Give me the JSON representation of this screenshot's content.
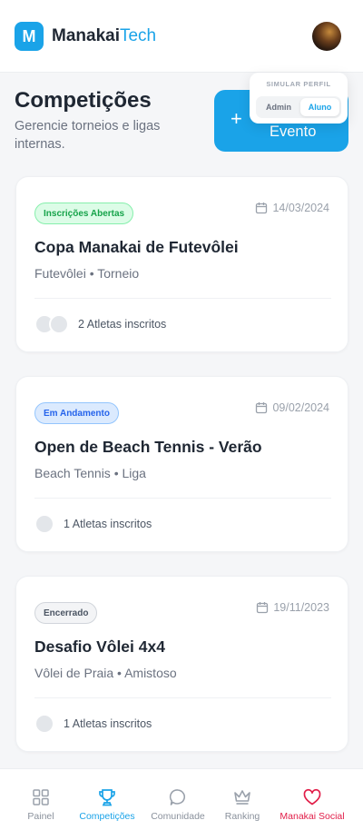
{
  "header": {
    "logo_letter": "M",
    "brand_bold": "Manakai",
    "brand_light": "Tech"
  },
  "profile_switch": {
    "label": "SIMULAR PERFIL",
    "options": [
      "Admin",
      "Aluno"
    ],
    "selected": "Aluno"
  },
  "page": {
    "title": "Competições",
    "subtitle": "Gerencie torneios e ligas internas.",
    "new_button_icon": "+",
    "new_button_label": "Evento"
  },
  "events": [
    {
      "status": "Inscrições Abertas",
      "status_color": "#16a34a",
      "date": "14/03/2024",
      "title": "Copa Manakai de Futevôlei",
      "meta": "Futevôlei • Torneio",
      "athletes": "2 Atletas inscritos"
    },
    {
      "status": "Em Andamento",
      "status_color": "#2563eb",
      "date": "09/02/2024",
      "title": "Open de Beach Tennis - Verão",
      "meta": "Beach Tennis • Liga",
      "athletes": "1 Atletas inscritos"
    },
    {
      "status": "Encerrado",
      "status_color": "#4b5563",
      "date": "19/11/2023",
      "title": "Desafio Vôlei 4x4",
      "meta": "Vôlei de Praia • Amistoso",
      "athletes": "1 Atletas inscritos"
    }
  ],
  "nav": {
    "items": [
      {
        "label": "Painel",
        "icon": "grid-icon"
      },
      {
        "label": "Competições",
        "icon": "trophy-icon",
        "active": true
      },
      {
        "label": "Comunidade",
        "icon": "chat-bubble-icon"
      },
      {
        "label": "Ranking",
        "icon": "crown-icon"
      },
      {
        "label": "Manakai Social",
        "icon": "heart-icon"
      }
    ]
  },
  "colors": {
    "accent": "#1aa3e8",
    "social": "#e11d48"
  }
}
